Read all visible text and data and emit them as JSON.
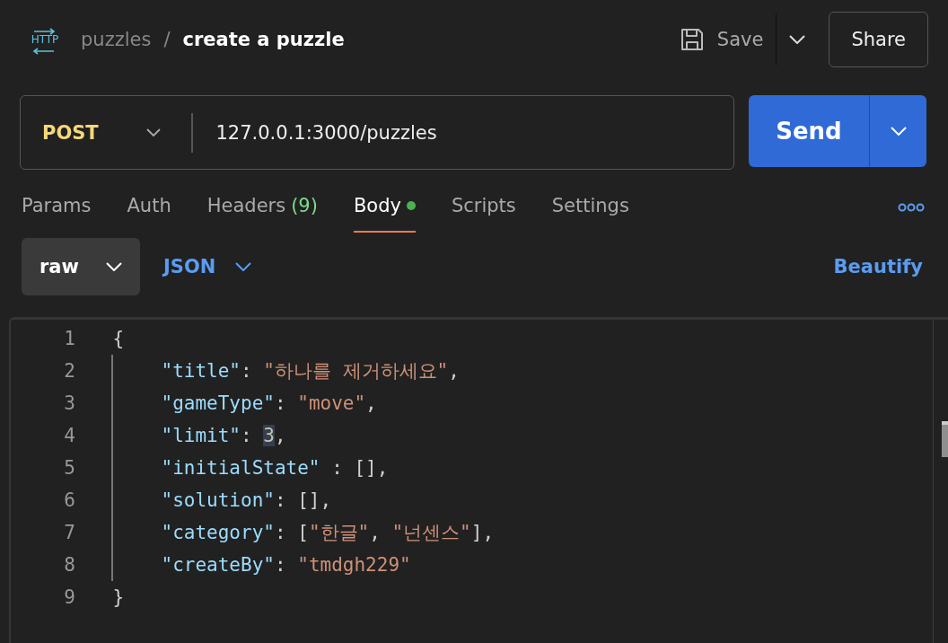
{
  "header": {
    "badge": "HTTP",
    "collection": "puzzles",
    "separator": "/",
    "request_name": "create a puzzle",
    "save_label": "Save",
    "share_label": "Share"
  },
  "request": {
    "method": "POST",
    "url": "127.0.0.1:3000/puzzles",
    "send_label": "Send"
  },
  "tabs": [
    {
      "label": "Params",
      "selected": false,
      "dot": false
    },
    {
      "label": "Auth",
      "selected": false,
      "dot": false
    },
    {
      "label": "Headers",
      "selected": false,
      "count": "(9)",
      "dot": false
    },
    {
      "label": "Body",
      "selected": true,
      "dot": true
    },
    {
      "label": "Scripts",
      "selected": false,
      "dot": false
    },
    {
      "label": "Settings",
      "selected": false,
      "dot": false
    }
  ],
  "body_options": {
    "mode": "raw",
    "language": "JSON",
    "beautify_label": "Beautify"
  },
  "editor": {
    "lines": [
      {
        "number": "1",
        "tokens": [
          {
            "kind": "punct",
            "text": "{",
            "highlighted": false
          }
        ],
        "children": [
          {
            "number": "2",
            "tokens": [
              {
                "kind": "key",
                "text": "\"title\"",
                "highlighted": false
              },
              {
                "kind": "punct",
                "text": ": ",
                "highlighted": false
              },
              {
                "kind": "string",
                "text": "\"하나를 제거하세요\"",
                "highlighted": false
              },
              {
                "kind": "punct",
                "text": ",",
                "highlighted": false
              }
            ]
          },
          {
            "number": "3",
            "tokens": [
              {
                "kind": "key",
                "text": "\"gameType\"",
                "highlighted": false
              },
              {
                "kind": "punct",
                "text": ": ",
                "highlighted": false
              },
              {
                "kind": "string",
                "text": "\"move\"",
                "highlighted": false
              },
              {
                "kind": "punct",
                "text": ",",
                "highlighted": false
              }
            ]
          },
          {
            "number": "4",
            "tokens": [
              {
                "kind": "key",
                "text": "\"limit\"",
                "highlighted": false
              },
              {
                "kind": "punct",
                "text": ": ",
                "highlighted": false
              },
              {
                "kind": "number",
                "text": "3",
                "highlighted": true
              },
              {
                "kind": "punct",
                "text": ",",
                "highlighted": false
              }
            ]
          },
          {
            "number": "5",
            "tokens": [
              {
                "kind": "key",
                "text": "\"initialState\"",
                "highlighted": false
              },
              {
                "kind": "punct",
                "text": " : [],",
                "highlighted": false
              }
            ]
          },
          {
            "number": "6",
            "tokens": [
              {
                "kind": "key",
                "text": "\"solution\"",
                "highlighted": false
              },
              {
                "kind": "punct",
                "text": ": [],",
                "highlighted": false
              }
            ]
          },
          {
            "number": "7",
            "tokens": [
              {
                "kind": "key",
                "text": "\"category\"",
                "highlighted": false
              },
              {
                "kind": "punct",
                "text": ": [",
                "highlighted": false
              },
              {
                "kind": "string",
                "text": "\"한글\"",
                "highlighted": false
              },
              {
                "kind": "punct",
                "text": ", ",
                "highlighted": false
              },
              {
                "kind": "string",
                "text": "\"넌센스\"",
                "highlighted": false
              },
              {
                "kind": "punct",
                "text": "],",
                "highlighted": false
              }
            ]
          },
          {
            "number": "8",
            "tokens": [
              {
                "kind": "key",
                "text": "\"createBy\"",
                "highlighted": false
              },
              {
                "kind": "punct",
                "text": ": ",
                "highlighted": false
              },
              {
                "kind": "string",
                "text": "\"tmdgh229\"",
                "highlighted": false
              }
            ]
          }
        ]
      },
      {
        "number": "9",
        "tokens": [
          {
            "kind": "punct",
            "text": "}",
            "highlighted": false
          }
        ]
      }
    ]
  }
}
